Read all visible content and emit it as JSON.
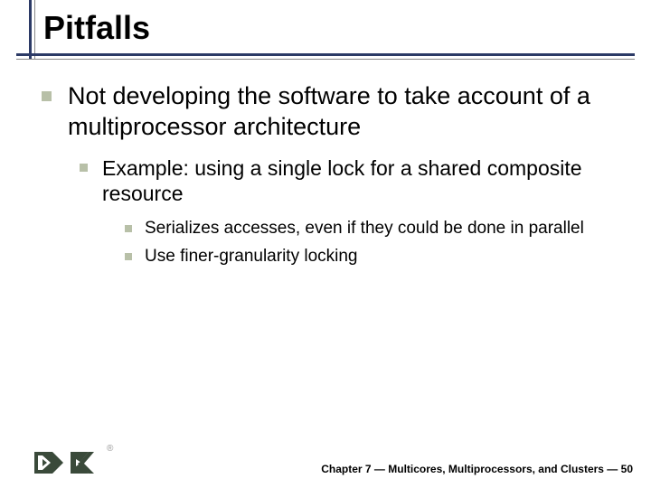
{
  "title": "Pitfalls",
  "bullets": {
    "l1": "Not developing the software to take account of a multiprocessor architecture",
    "l2": "Example: using a single lock for a shared composite resource",
    "l3a": "Serializes accesses, even if they could be done in parallel",
    "l3b": "Use finer-granularity locking"
  },
  "footer": "Chapter 7 — Multicores, Multiprocessors, and Clusters — 50",
  "registered": "®"
}
